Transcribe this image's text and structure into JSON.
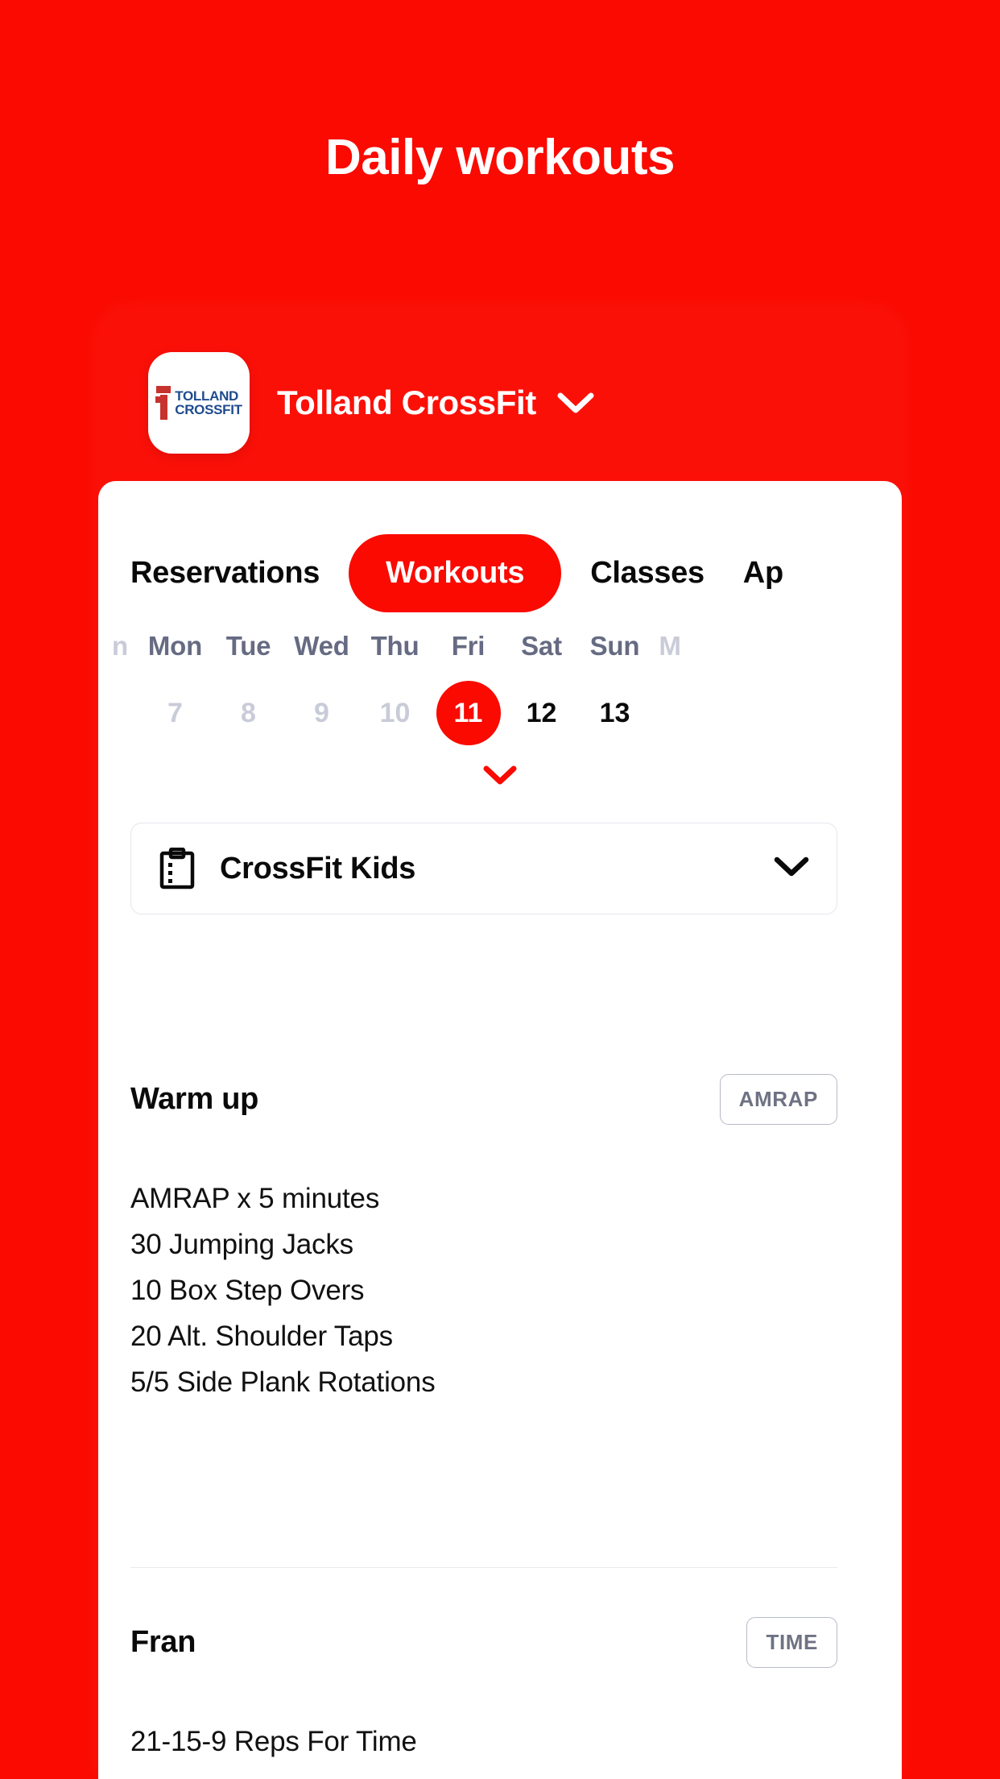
{
  "header": {
    "title": "Daily workouts"
  },
  "gym": {
    "name": "Tolland CrossFit",
    "logo_line1": "TOLLAND",
    "logo_line2": "CROSSFIT",
    "caret_icon": "chevron-down-icon"
  },
  "tabs": [
    {
      "label": "Reservations",
      "active": false
    },
    {
      "label": "Workouts",
      "active": true
    },
    {
      "label": "Classes",
      "active": false
    },
    {
      "label": "Ap",
      "active": false
    }
  ],
  "calendar": {
    "expand_icon": "chevron-down-icon",
    "days": [
      {
        "dow": "n",
        "num": "",
        "state": "edge"
      },
      {
        "dow": "Mon",
        "num": "7",
        "state": "past"
      },
      {
        "dow": "Tue",
        "num": "8",
        "state": "past"
      },
      {
        "dow": "Wed",
        "num": "9",
        "state": "past"
      },
      {
        "dow": "Thu",
        "num": "10",
        "state": "past"
      },
      {
        "dow": "Fri",
        "num": "11",
        "state": "selected"
      },
      {
        "dow": "Sat",
        "num": "12",
        "state": "normal"
      },
      {
        "dow": "Sun",
        "num": "13",
        "state": "normal"
      },
      {
        "dow": "M",
        "num": "",
        "state": "edge"
      }
    ]
  },
  "selector": {
    "icon": "clipboard-icon",
    "label": "CrossFit Kids",
    "caret_icon": "chevron-down-icon"
  },
  "workouts": [
    {
      "title": "Warm up",
      "badge": "AMRAP",
      "lines": [
        "AMRAP x 5 minutes",
        "30 Jumping Jacks",
        "10 Box Step Overs",
        "20 Alt. Shoulder Taps",
        "5/5 Side Plank Rotations"
      ]
    },
    {
      "title": "Fran",
      "badge": "TIME",
      "lines": [
        "21-15-9 Reps For Time"
      ]
    }
  ],
  "colors": {
    "brand_red": "#fa0a00",
    "text_dark": "#0a0a0a",
    "muted": "#666b83",
    "faded": "#c9ccd8",
    "badge_border": "#b7bac7",
    "badge_text": "#6e7283",
    "logo_navy": "#1f4b8e",
    "logo_red": "#c8322e"
  }
}
